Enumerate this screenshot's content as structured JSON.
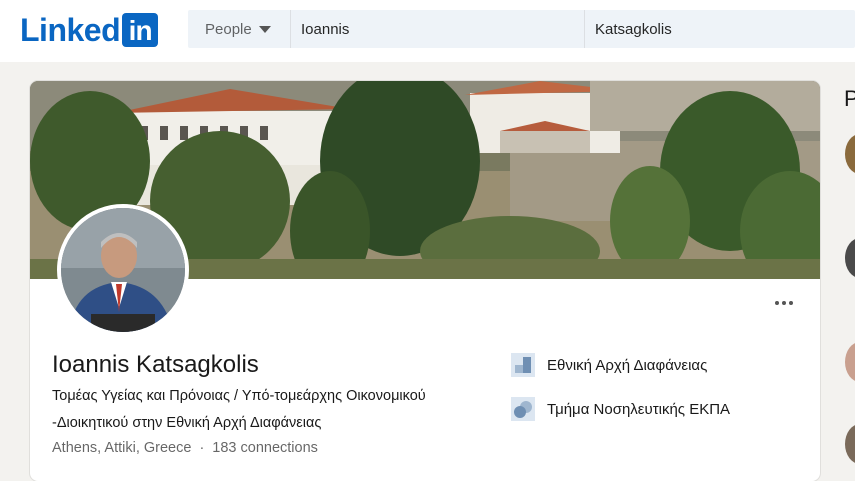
{
  "header": {
    "logo_text": "Linked",
    "logo_in": "in",
    "search": {
      "type_label": "People",
      "first_name": "Ioannis",
      "last_name": "Katsagkolis"
    }
  },
  "profile": {
    "name": "Ioannis Katsagkolis",
    "headline_line1": "Τομέας Υγείας και Πρόνοιας / Υπό-τομεάρχης Οικονομικού",
    "headline_line2": "-Διοικητικού στην Εθνική Αρχή Διαφάνειας",
    "location": "Athens, Attiki, Greece",
    "separator": "·",
    "connections": "183 connections",
    "more_label": "More actions",
    "companies": [
      {
        "name": "Εθνική Αρχή Διαφάνειας",
        "icon": "company-logo-icon"
      },
      {
        "name": "Τμήμα Νοσηλευτικής ΕΚΠΑ",
        "icon": "school-logo-icon"
      }
    ]
  },
  "sidebar": {
    "heading_partial": "P"
  },
  "colors": {
    "brand": "#0a66c2",
    "background": "#f3f2ef",
    "search_bg": "#eef3f8"
  }
}
